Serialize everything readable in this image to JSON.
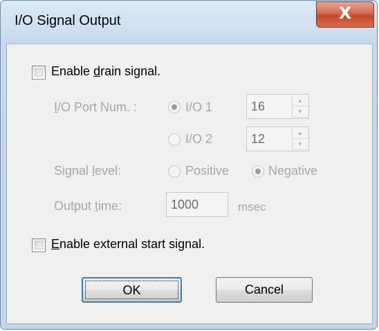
{
  "window": {
    "title": "I/O Signal Output",
    "close_glyph": "X"
  },
  "drain": {
    "checkbox_label_pre": "Enable ",
    "checkbox_label_mnemonic": "d",
    "checkbox_label_post": "rain signal.",
    "checked": false
  },
  "port": {
    "label_mnemonic": "I",
    "label_rest": "/O Port Num. :",
    "option1_label": "I/O 1",
    "option1_value": "16",
    "option2_label": "I/O 2",
    "option2_value": "12",
    "selected": "I/O 1"
  },
  "level": {
    "label_pre": "Signal ",
    "label_mnemonic": "l",
    "label_post": "evel:",
    "positive_label": "Positive",
    "negative_label": "Negative",
    "selected": "Negative"
  },
  "output": {
    "label_pre": "Output ",
    "label_mnemonic": "t",
    "label_post": "ime:",
    "value": "1000",
    "unit": "msec"
  },
  "external": {
    "checkbox_label_mnemonic": "E",
    "checkbox_label_post": "nable external start signal.",
    "checked": false
  },
  "buttons": {
    "ok_label": "OK",
    "cancel_label": "Cancel"
  },
  "colors": {
    "disabled_text": "#a6a6a6",
    "close_button": "#c4472c",
    "default_button_border": "#3c7fb1"
  }
}
